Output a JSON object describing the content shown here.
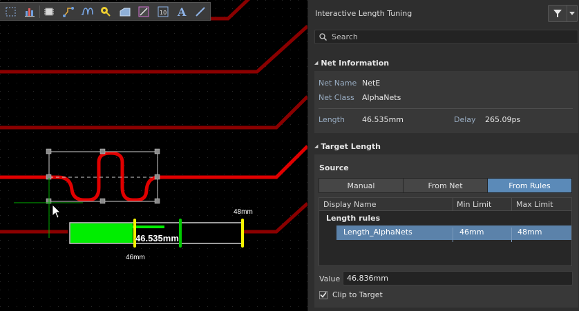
{
  "canvas": {
    "length_readout": "46.535mm",
    "min_marker_label": "46mm",
    "max_marker_label": "48mm",
    "progress": {
      "min": 46,
      "max": 48,
      "current": 46.535
    }
  },
  "toolbar": {
    "tools": [
      {
        "name": "select-icon"
      },
      {
        "name": "interactive-routing-icon"
      },
      {
        "name": "component-icon"
      },
      {
        "name": "route-icon"
      },
      {
        "name": "length-tuning-icon"
      },
      {
        "name": "via-icon"
      },
      {
        "name": "polygon-icon"
      },
      {
        "name": "place-fill-icon"
      },
      {
        "name": "designator-icon"
      },
      {
        "name": "string-icon"
      },
      {
        "name": "line-icon"
      }
    ]
  },
  "panel": {
    "title": "Interactive Length Tuning",
    "search_placeholder": "Search",
    "net_information": {
      "heading": "Net Information",
      "net_name_label": "Net Name",
      "net_name": "NetE",
      "net_class_label": "Net Class",
      "net_class": "AlphaNets",
      "length_label": "Length",
      "length": "46.535mm",
      "delay_label": "Delay",
      "delay": "265.09ps"
    },
    "target_length": {
      "heading": "Target Length",
      "source_label": "Source",
      "source_options": [
        "Manual",
        "From Net",
        "From Rules"
      ],
      "active_source": "From Rules",
      "grid_headers": [
        "Display Name",
        "Min Limit",
        "Max Limit"
      ],
      "group": "Length rules",
      "rule": {
        "name": "Length_AlphaNets",
        "min": "46mm",
        "max": "48mm"
      },
      "value_label": "Value",
      "value": "46.836mm",
      "clip_label": "Clip to Target",
      "clip_checked": true
    }
  },
  "colors": {
    "track": "#d40000",
    "track_dim": "#7a0000",
    "meter_fill": "#00ee00",
    "meter_min": "#f5f500",
    "meter_target": "#00cc00",
    "active_accent": "#5b8ab8"
  }
}
